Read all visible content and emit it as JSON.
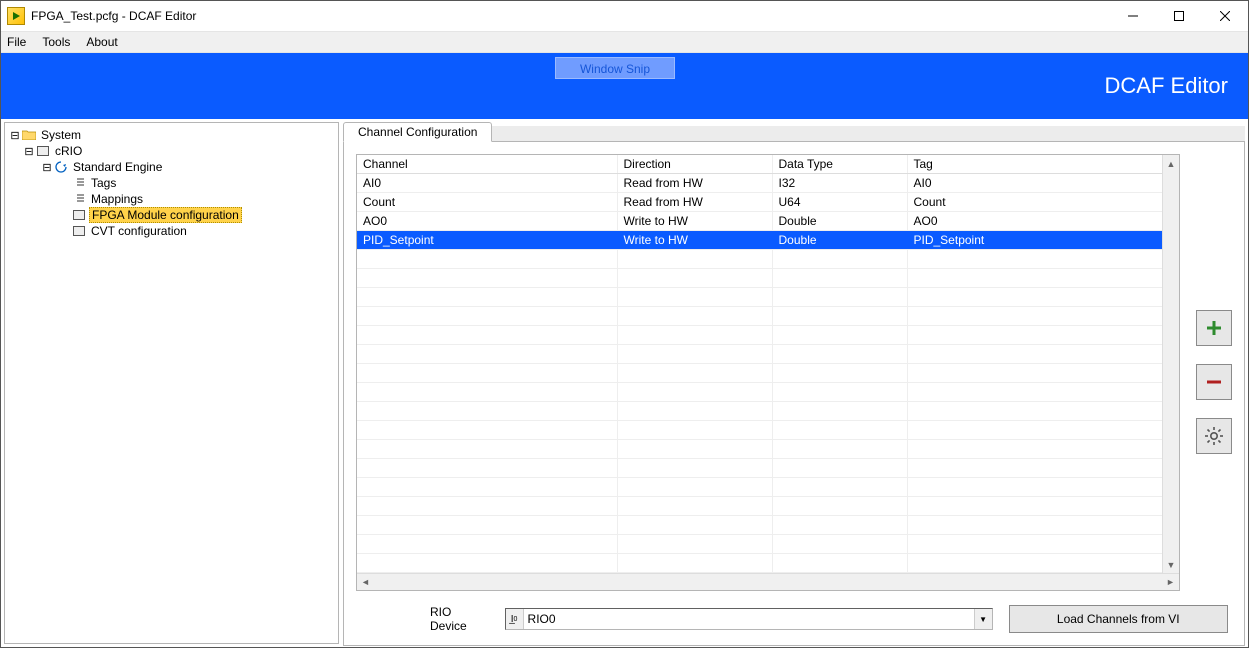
{
  "window": {
    "title": "FPGA_Test.pcfg - DCAF Editor"
  },
  "menubar": {
    "file": "File",
    "tools": "Tools",
    "about": "About"
  },
  "banner": {
    "title": "DCAF Editor",
    "ghost": "Window Snip"
  },
  "tree": {
    "root": "System",
    "crio": "cRIO",
    "engine": "Standard Engine",
    "tags": "Tags",
    "mappings": "Mappings",
    "fpga": "FPGA Module configuration",
    "cvt": "CVT configuration"
  },
  "tab": {
    "label": "Channel Configuration"
  },
  "table": {
    "headers": {
      "channel": "Channel",
      "direction": "Direction",
      "datatype": "Data Type",
      "tag": "Tag"
    },
    "rows": [
      {
        "channel": "AI0",
        "direction": "Read from HW",
        "datatype": "I32",
        "tag": "AI0",
        "selected": false
      },
      {
        "channel": "Count",
        "direction": "Read from HW",
        "datatype": "U64",
        "tag": "Count",
        "selected": false
      },
      {
        "channel": "AO0",
        "direction": "Write to HW",
        "datatype": "Double",
        "tag": "AO0",
        "selected": false
      },
      {
        "channel": "PID_Setpoint",
        "direction": "Write to HW",
        "datatype": "Double",
        "tag": "PID_Setpoint",
        "selected": true
      }
    ]
  },
  "rio": {
    "label": "RIO Device",
    "value": "RIO0"
  },
  "buttons": {
    "load": "Load Channels from VI"
  }
}
